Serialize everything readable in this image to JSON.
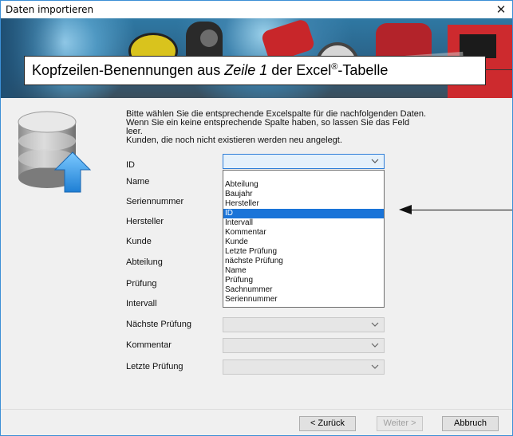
{
  "window": {
    "title": "Daten importieren",
    "close_glyph": "✕"
  },
  "callout": {
    "prefix": "Kopfzeilen-Benennungen aus ",
    "italic": "Zeile 1",
    "middle": " der Excel",
    "sup": "®",
    "suffix": "-Tabelle"
  },
  "intro": {
    "line1": "Bitte wählen Sie die entsprechende Excelspalte für die nachfolgenden Daten.",
    "line2": "Wenn Sie ein keine entsprechende Spalte haben, so lassen Sie das Feld",
    "line3": "leer.",
    "line4": "Kunden, die noch nicht existieren werden neu angelegt."
  },
  "fields": {
    "id": "ID",
    "name": "Name",
    "seriennummer": "Seriennummer",
    "hersteller": "Hersteller",
    "kunde": "Kunde",
    "abteilung": "Abteilung",
    "pruefung": "Prüfung",
    "intervall": "Intervall",
    "naechste_pruefung": "Nächste Prüfung",
    "kommentar": "Kommentar",
    "letzte_pruefung": "Letzte Prüfung"
  },
  "dropdown": {
    "options": [
      "Abteilung",
      "Baujahr",
      "Hersteller",
      "ID",
      "Intervall",
      "Kommentar",
      "Kunde",
      "Letzte Prüfung",
      "nächste Prüfung",
      "Name",
      "Prüfung",
      "Sachnummer",
      "Seriennummer"
    ],
    "selected": "ID"
  },
  "buttons": {
    "back": "< Zurück",
    "next": "Weiter >",
    "cancel": "Abbruch"
  },
  "icons": {
    "database": "database-import-icon",
    "chevron": "chevron-down-icon",
    "arrow": "pointer-arrow"
  },
  "colors": {
    "accent": "#1a74d8",
    "window_border": "#3c8fd6",
    "banner": "#2a6186"
  }
}
